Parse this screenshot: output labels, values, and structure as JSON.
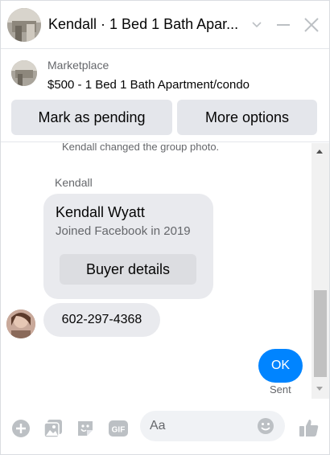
{
  "header": {
    "title": "Kendall · 1 Bed 1 Bath Apar...",
    "avatar_icon": "listing-photo-avatar",
    "chevron_icon": "chevron-down-icon",
    "minimize_icon": "minimize-icon",
    "close_icon": "close-icon"
  },
  "marketplace": {
    "label": "Marketplace",
    "listing": "$500 - 1 Bed 1 Bath Apartment/condo",
    "buttons": {
      "mark_pending": "Mark as pending",
      "more_options": "More options"
    }
  },
  "conversation": {
    "system_message": "Kendall changed the group photo.",
    "sender_name": "Kendall",
    "profile_card": {
      "name": "Kendall Wyatt",
      "subtitle": "Joined Facebook in 2019",
      "button": "Buyer details"
    },
    "incoming_message": "602-297-4368",
    "outgoing_message": "OK",
    "outgoing_status": "Sent"
  },
  "composer": {
    "placeholder": "Aa",
    "icons": [
      "plus-icon",
      "photo-icon",
      "sticker-icon",
      "gif-icon",
      "emoji-icon",
      "like-icon"
    ],
    "gif_text": "GIF"
  },
  "colors": {
    "accent": "#0084ff",
    "bubble_grey": "#e9eaee",
    "button_grey": "#e4e6eb",
    "icon_grey": "#bcc0c4",
    "secondary_text": "#65676b"
  }
}
